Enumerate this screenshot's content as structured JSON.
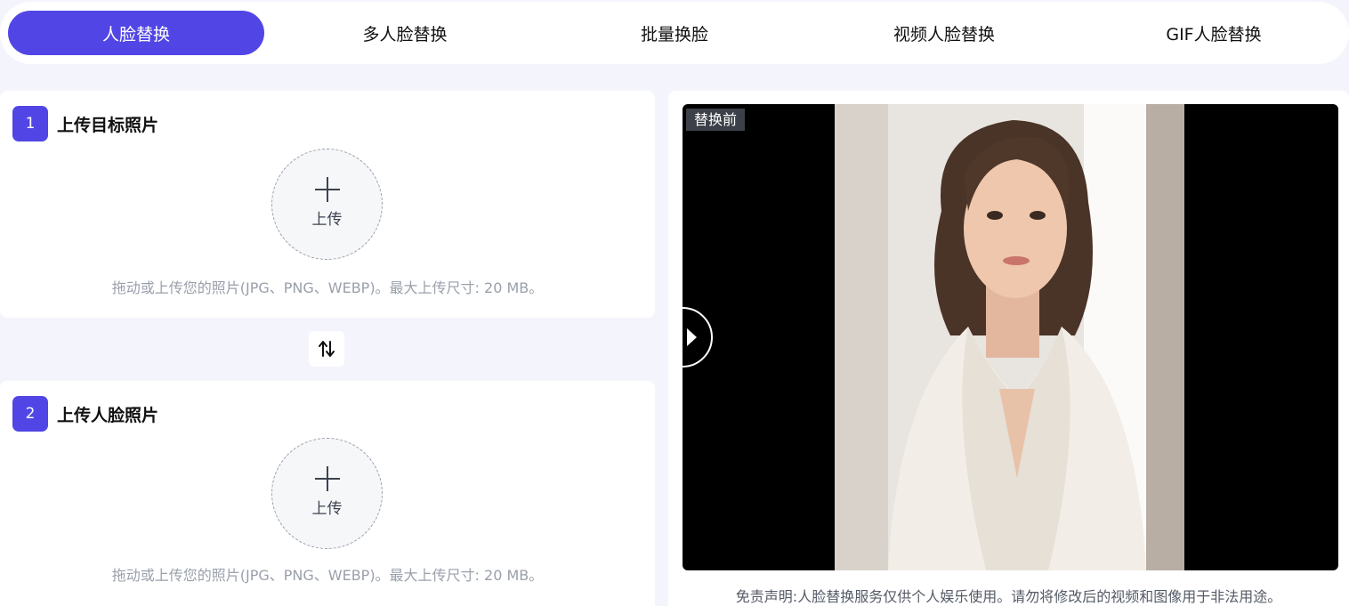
{
  "tabs": [
    {
      "label": "人脸替换",
      "active": true
    },
    {
      "label": "多人脸替换",
      "active": false
    },
    {
      "label": "批量换脸",
      "active": false
    },
    {
      "label": "视频人脸替换",
      "active": false
    },
    {
      "label": "GIF人脸替换",
      "active": false
    }
  ],
  "step1": {
    "number": "1",
    "title": "上传目标照片",
    "upload_label": "上传",
    "hint": "拖动或上传您的照片(JPG、PNG、WEBP)。最大上传尺寸: 20 MB。"
  },
  "step2": {
    "number": "2",
    "title": "上传人脸照片",
    "upload_label": "上传",
    "hint": "拖动或上传您的照片(JPG、PNG、WEBP)。最大上传尺寸: 20 MB。"
  },
  "preview": {
    "tag": "替换前"
  },
  "disclaimer": "免责声明:人脸替换服务仅供个人娱乐使用。请勿将修改后的视频和图像用于非法用途。",
  "colors": {
    "accent": "#5146e5",
    "background": "#f4f5fc",
    "hint_text": "#9aa0ab"
  },
  "icons": {
    "upload": "plus-icon",
    "swap": "swap-vertical-icon",
    "slider": "play-triangle-icon"
  }
}
